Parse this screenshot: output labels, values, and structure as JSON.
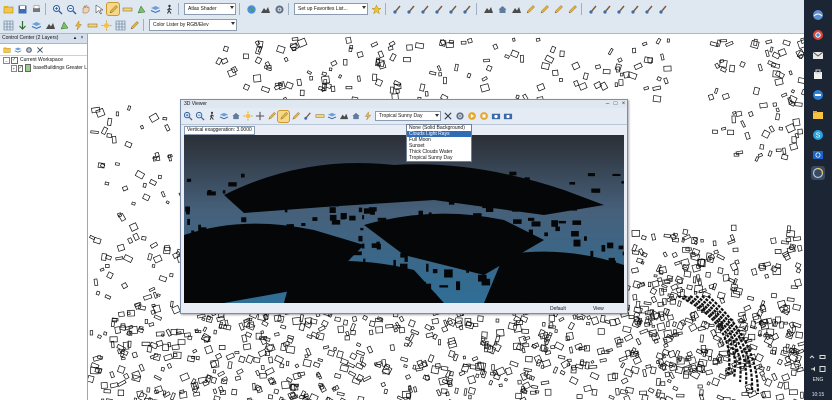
{
  "toolbar": {
    "shader": "Atlas Shader",
    "favorites": "Set up Favorites List...",
    "color_lister": "Color Lister by RGB/Elev"
  },
  "control_center": {
    "title": "Control Center (2 Layers)",
    "workspace": "Current Workspace",
    "layer": "baseBuildings Greater L"
  },
  "viewer": {
    "title": "3D Viewer",
    "lighting_selected": "Tropical Sunny Day",
    "lighting_options": [
      "None (Solid Background)",
      "Clouds Light Rays",
      "Full Moon",
      "Sunset",
      "Thick Clouds Water",
      "Tropical Sunny Day"
    ],
    "highlighted_index": 1,
    "vertical_exaggeration": "Vertical exaggeration: 3.0000",
    "status_left": "Default",
    "status_right": "View"
  },
  "taskbar": {
    "language": "ENG",
    "time": "10:15"
  },
  "colors": {
    "toolbar_bg": "#dfe7f1",
    "taskbar_bg": "#1b2534",
    "sky_top": "#2b2f36",
    "water": "#2f6e96",
    "selection": "#2f6cb5"
  }
}
